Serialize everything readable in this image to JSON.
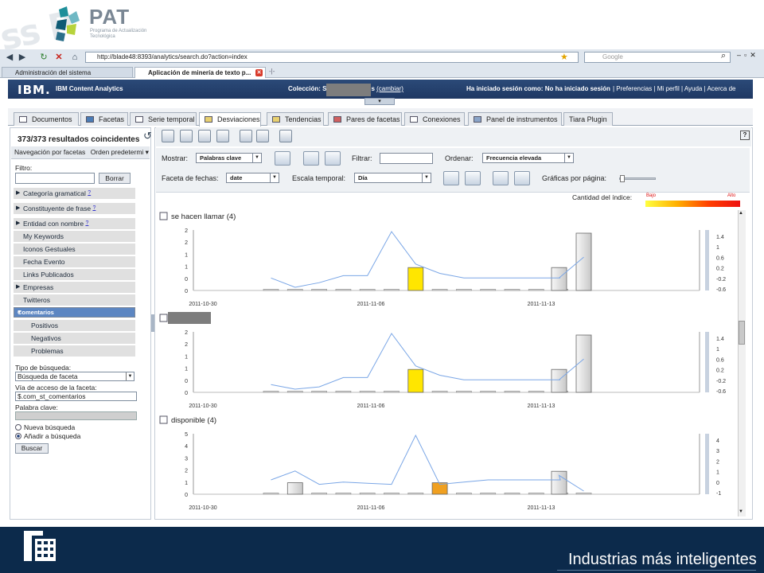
{
  "banner": {
    "deco": "ss P",
    "name": "PAT",
    "subtitle": "Programa de Actualización Tecnológica"
  },
  "browser": {
    "url": "http://blade48:8393/analytics/search.do?action=index",
    "search_placeholder": "Google",
    "tabs": [
      {
        "label": "Administración del sistema"
      },
      {
        "label": "Aplicación de minería de texto p..."
      }
    ]
  },
  "header": {
    "brand": "IBM.",
    "app": "IBM Content Analytics",
    "collection_prefix": "Colección: S",
    "collection_suffix": "s",
    "change": "(cambiar)",
    "session": "Ha iniciado sesión como: No ha iniciado sesión",
    "links": "| Preferencias | Mi perfil | Ayuda | Acerca de"
  },
  "tabs": [
    {
      "label": "Documentos"
    },
    {
      "label": "Facetas"
    },
    {
      "label": "Serie temporal"
    },
    {
      "label": "Desviaciones"
    },
    {
      "label": "Tendencias"
    },
    {
      "label": "Pares de facetas"
    },
    {
      "label": "Conexiones"
    },
    {
      "label": "Panel de instrumentos"
    },
    {
      "label": "Tiara Plugin"
    }
  ],
  "left": {
    "results": "373/373 resultados coincidentes",
    "nav_label": "Navegación por facetas",
    "order": "Orden predetermi",
    "filter_label": "Filtro:",
    "clear": "Borrar",
    "facets": [
      {
        "label": "Categoría gramatical",
        "help": "?"
      },
      {
        "label": "Constituyente de frase",
        "help": "?"
      },
      {
        "label": "Entidad con nombre",
        "help": "?"
      },
      {
        "label": "My Keywords"
      },
      {
        "label": "Iconos Gestuales"
      },
      {
        "label": "Fecha Evento"
      },
      {
        "label": "Links Publicados"
      },
      {
        "label": "Empresas"
      },
      {
        "label": "Twitteros"
      },
      {
        "label": "Comentarios"
      },
      {
        "label": "Positivos"
      },
      {
        "label": "Negativos"
      },
      {
        "label": "Problemas"
      }
    ],
    "search_type_label": "Tipo de búsqueda:",
    "search_type": "Búsqueda de faceta",
    "path_label": "Vía de acceso de la faceta:",
    "path": "$.com_st_comentarios",
    "keyword_label": "Palabra clave:",
    "new_search": "Nueva búsqueda",
    "add_search": "Añadir a búsqueda",
    "search": "Buscar"
  },
  "options": {
    "show_label": "Mostrar:",
    "show_value": "Palabras clave",
    "filter_label": "Filtrar:",
    "order_label": "Ordenar:",
    "order_value": "Frecuencia elevada",
    "date_facet_label": "Faceta de fechas:",
    "date_facet_value": "date",
    "scale_label": "Escala temporal:",
    "scale_value": "Día",
    "per_page_label": "Gráficas por página:",
    "index_label": "Cantidad del índice:",
    "low": "Bajo",
    "high": "Alto"
  },
  "footer": {
    "slogan": "Industrias más inteligentes"
  },
  "chart_data": [
    {
      "type": "bar",
      "title": "se hacen llamar (4)",
      "x_ticks": [
        "2011-10-30",
        "2011-11-06",
        "2011-11-13"
      ],
      "left_ticks": [
        "2",
        "2",
        "1",
        "1",
        "0",
        "0"
      ],
      "right_ticks": [
        "1.4",
        "1",
        "0.6",
        "0.2",
        "-0.2",
        "-0.6"
      ],
      "bar_values": [
        0,
        0,
        0,
        0,
        0,
        0,
        0.8,
        0,
        0,
        0,
        0,
        0,
        0,
        0.8,
        2
      ],
      "bar_colors": [
        "#eee",
        "#eee",
        "#eee",
        "#eee",
        "#eee",
        "#eee",
        "#ffe600",
        "#eee",
        "#eee",
        "#eee",
        "#eee",
        "#eee",
        "#eee",
        "#ddd",
        "#ddd"
      ],
      "line_values": [
        -0.4,
        -0.8,
        -0.6,
        -0.3,
        -0.3,
        1.6,
        0.2,
        -0.2,
        -0.4,
        -0.4,
        -0.4,
        -0.4,
        -0.4,
        -0.4,
        0.5
      ]
    },
    {
      "type": "bar",
      "title": "",
      "x_ticks": [
        "2011-10-30",
        "2011-11-06",
        "2011-11-13"
      ],
      "left_ticks": [
        "2",
        "2",
        "1",
        "1",
        "0",
        "0"
      ],
      "right_ticks": [
        "1.4",
        "1",
        "0.6",
        "0.2",
        "-0.2",
        "-0.6"
      ],
      "bar_values": [
        0,
        0,
        0,
        0,
        0,
        0,
        0.8,
        0,
        0,
        0,
        0,
        0,
        0,
        0.8,
        2
      ],
      "bar_colors": [
        "#eee",
        "#eee",
        "#eee",
        "#eee",
        "#eee",
        "#eee",
        "#ffe600",
        "#eee",
        "#eee",
        "#eee",
        "#eee",
        "#eee",
        "#eee",
        "#ddd",
        "#ddd"
      ],
      "line_values": [
        -0.6,
        -0.8,
        -0.7,
        -0.3,
        -0.3,
        1.6,
        0.2,
        -0.2,
        -0.4,
        -0.4,
        -0.4,
        -0.4,
        -0.4,
        -0.4,
        0.5
      ]
    },
    {
      "type": "bar",
      "title": "disponible (4)",
      "x_ticks": [
        "2011-10-30",
        "2011-11-06",
        "2011-11-13"
      ],
      "left_ticks": [
        "5",
        "4",
        "3",
        "2",
        "1",
        "0"
      ],
      "right_ticks": [
        "4",
        "3",
        "2",
        "1",
        "0",
        "-1"
      ],
      "bar_values": [
        0,
        1,
        0,
        0,
        0,
        0,
        0,
        1,
        0,
        0,
        0,
        0,
        0,
        2,
        0
      ],
      "bar_colors": [
        "#eee",
        "#ddd",
        "#eee",
        "#eee",
        "#eee",
        "#eee",
        "#eee",
        "#f0a020",
        "#eee",
        "#eee",
        "#eee",
        "#eee",
        "#eee",
        "#ddd",
        "#eee"
      ],
      "line_values": [
        0,
        0.8,
        -0.4,
        -0.2,
        -0.3,
        -0.4,
        4,
        -0.4,
        -0.2,
        0,
        0,
        0,
        0,
        0.4,
        -1
      ]
    }
  ]
}
